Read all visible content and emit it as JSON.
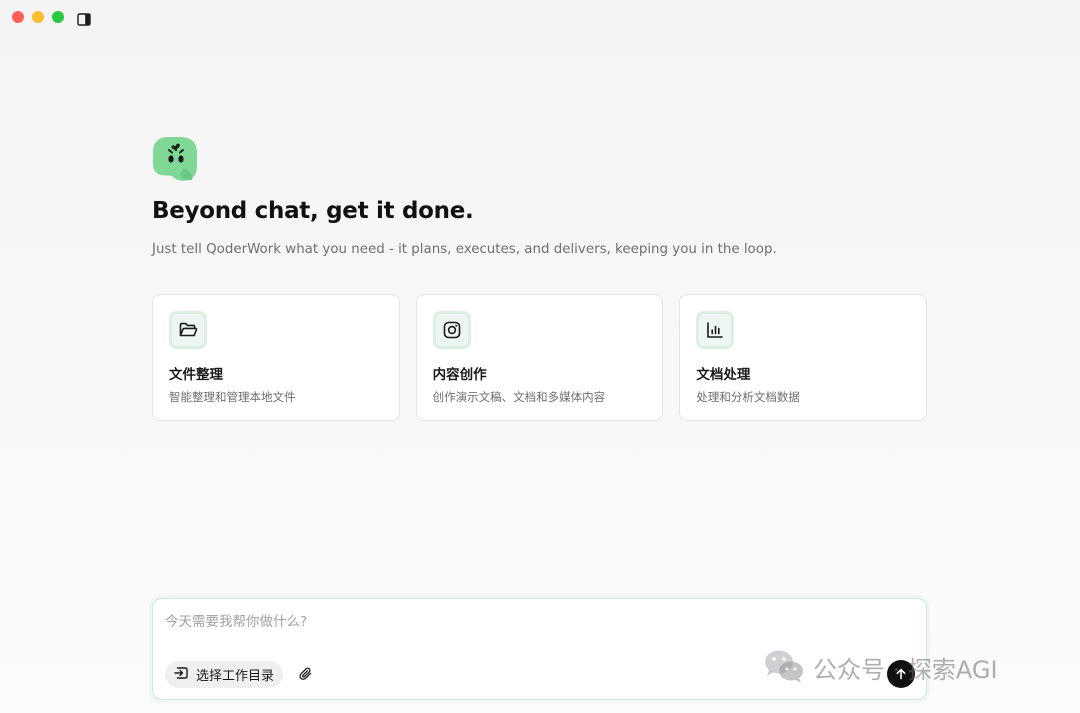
{
  "window": {
    "controls": [
      "close",
      "minimize",
      "zoom"
    ],
    "sidebar_toggle_icon": "sidebar-toggle-icon"
  },
  "hero": {
    "logo_icon": "qoder-mascot-logo",
    "headline": "Beyond chat, get it done.",
    "subline": "Just tell QoderWork what you need - it plans, executes, and delivers, keeping you in the loop."
  },
  "cards": [
    {
      "icon": "folder-open-icon",
      "title": "文件整理",
      "desc": "智能整理和管理本地文件"
    },
    {
      "icon": "instagram-icon",
      "title": "内容创作",
      "desc": "创作演示文稿、文档和多媒体内容"
    },
    {
      "icon": "bar-chart-icon",
      "title": "文档处理",
      "desc": "处理和分析文档数据"
    }
  ],
  "composer": {
    "placeholder": "今天需要我帮你做什么?",
    "value": "",
    "dir_button_label": "选择工作目录",
    "attach_icon": "paperclip-icon",
    "send_icon": "arrow-up-icon"
  },
  "watermark": {
    "icon": "wechat-icon",
    "text": "公众号 · 探索AGI"
  },
  "colors": {
    "accent_bg": "#edf6f0",
    "accent_border": "#cfe8da",
    "mascot_green": "#7fd896",
    "send_button": "#111111"
  }
}
